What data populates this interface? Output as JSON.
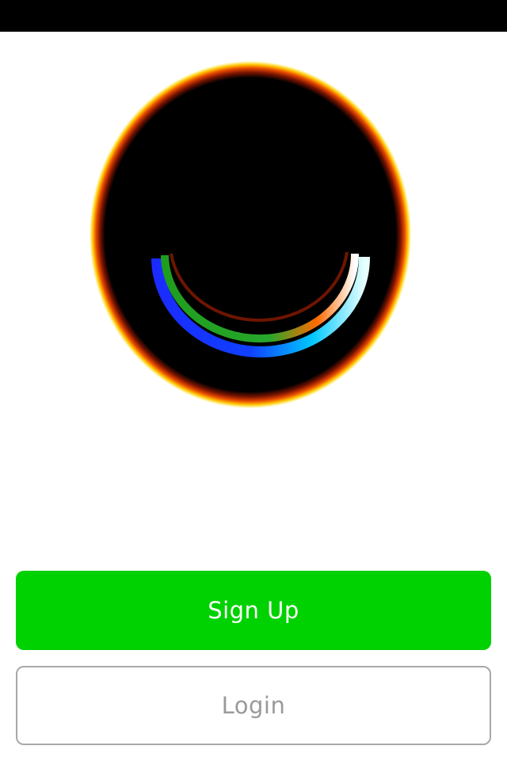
{
  "logo": {
    "icon": "smiley-face-logo-icon"
  },
  "actions": {
    "signup_label": "Sign Up",
    "login_label": "Login"
  },
  "colors": {
    "status_bar": "#000000",
    "background": "#ffffff",
    "signup_button": "#00d100",
    "signup_text": "#ffffff",
    "login_border": "#a8a8a8",
    "login_text": "#9a9a9a"
  }
}
